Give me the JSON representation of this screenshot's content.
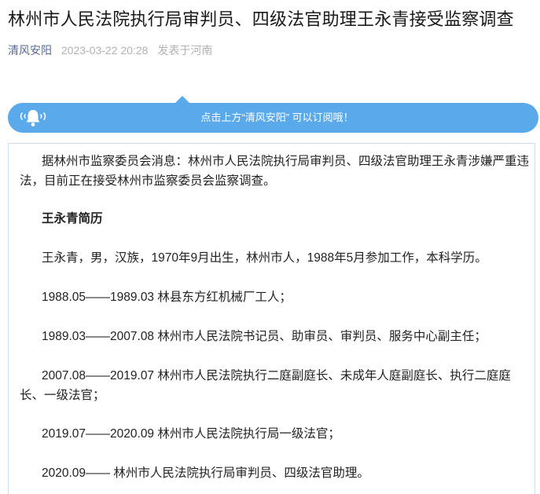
{
  "article": {
    "title": "林州市人民法院执行局审判员、四级法官助理王永青接受监察调查",
    "account": "清风安阳",
    "date": "2023-03-22 20:28",
    "location": "发表于河南"
  },
  "banner": {
    "text": "点击上方“清风安阳” 可以订阅哦！",
    "icon": "bell-icon",
    "color": "#5aa9ea"
  },
  "body": {
    "paragraphs": [
      "据林州市监察委员会消息：林州市人民法院执行局审判员、四级法官助理王永青涉嫌严重违法，目前正在接受林州市监察委员会监察调查。",
      "王永青简历",
      "王永青，男，汉族，1970年9月出生，林州市人，1988年5月参加工作，本科学历。",
      "1988.05——1989.03 林县东方红机械厂工人；",
      "1989.03——2007.08 林州市人民法院书记员、助审员、审判员、服务中心副主任；",
      "2007.08——2019.07 林州市人民法院执行二庭副庭长、未成年人庭副庭长、执行二庭庭长、一级法官；",
      "2019.07——2020.09 林州市人民法院执行局一级法官；",
      "2020.09—— 林州市人民法院执行局审判员、四级法官助理。"
    ]
  },
  "colors": {
    "meta_link": "#576b95",
    "meta_gray": "#b2b2b2",
    "content_border": "#cfdff0"
  }
}
